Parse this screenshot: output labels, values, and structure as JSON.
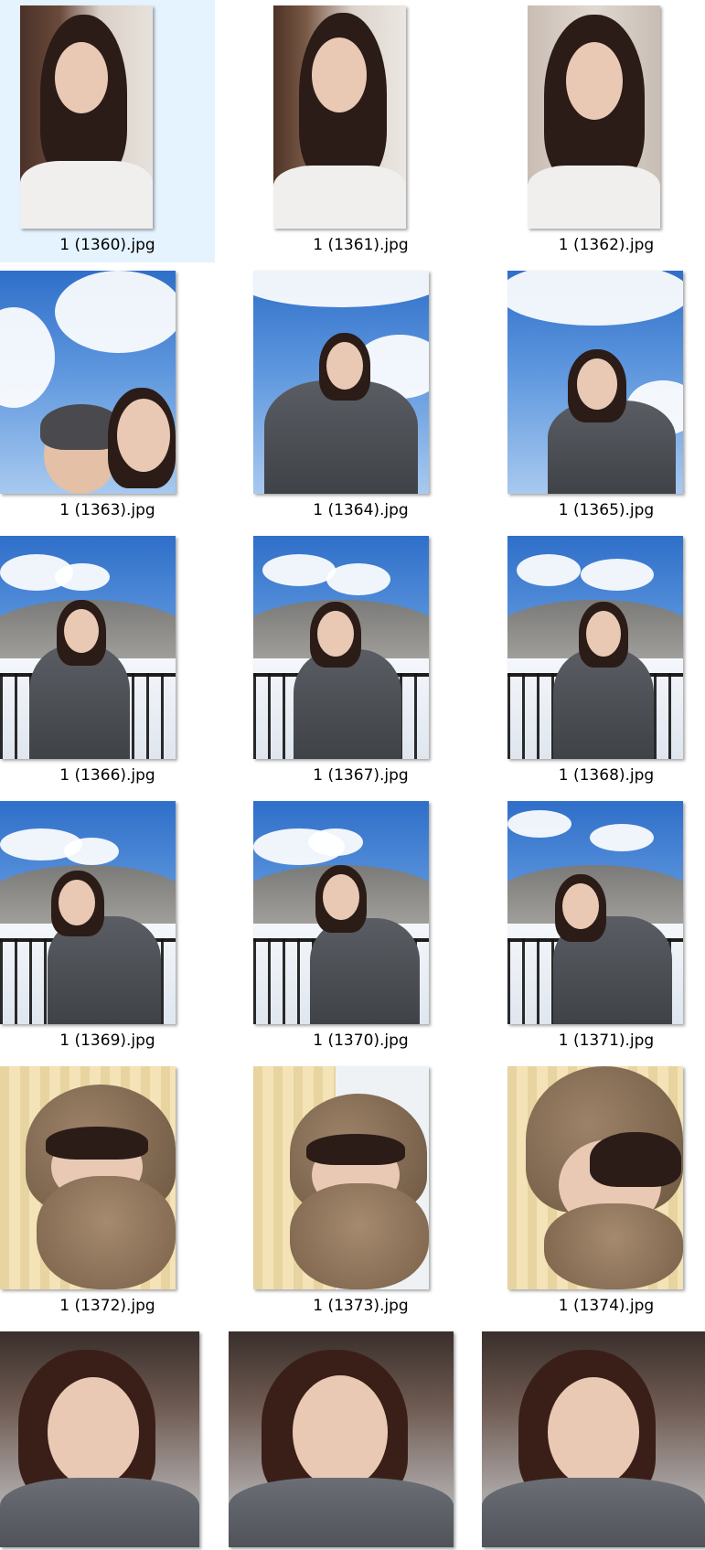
{
  "files": [
    {
      "name": "1 (1360).jpg",
      "selected": true
    },
    {
      "name": "1 (1361).jpg"
    },
    {
      "name": "1 (1362).jpg"
    },
    {
      "name": "1 (1363).jpg"
    },
    {
      "name": "1 (1364).jpg"
    },
    {
      "name": "1 (1365).jpg"
    },
    {
      "name": "1 (1366).jpg"
    },
    {
      "name": "1 (1367).jpg"
    },
    {
      "name": "1 (1368).jpg"
    },
    {
      "name": "1 (1369).jpg"
    },
    {
      "name": "1 (1370).jpg"
    },
    {
      "name": "1 (1371).jpg"
    },
    {
      "name": "1 (1372).jpg"
    },
    {
      "name": "1 (1373).jpg"
    },
    {
      "name": "1 (1374).jpg"
    },
    {
      "name": ""
    },
    {
      "name": ""
    },
    {
      "name": ""
    }
  ],
  "colors": {
    "selection": "#e5f3ff",
    "caption_text": "#000000"
  }
}
